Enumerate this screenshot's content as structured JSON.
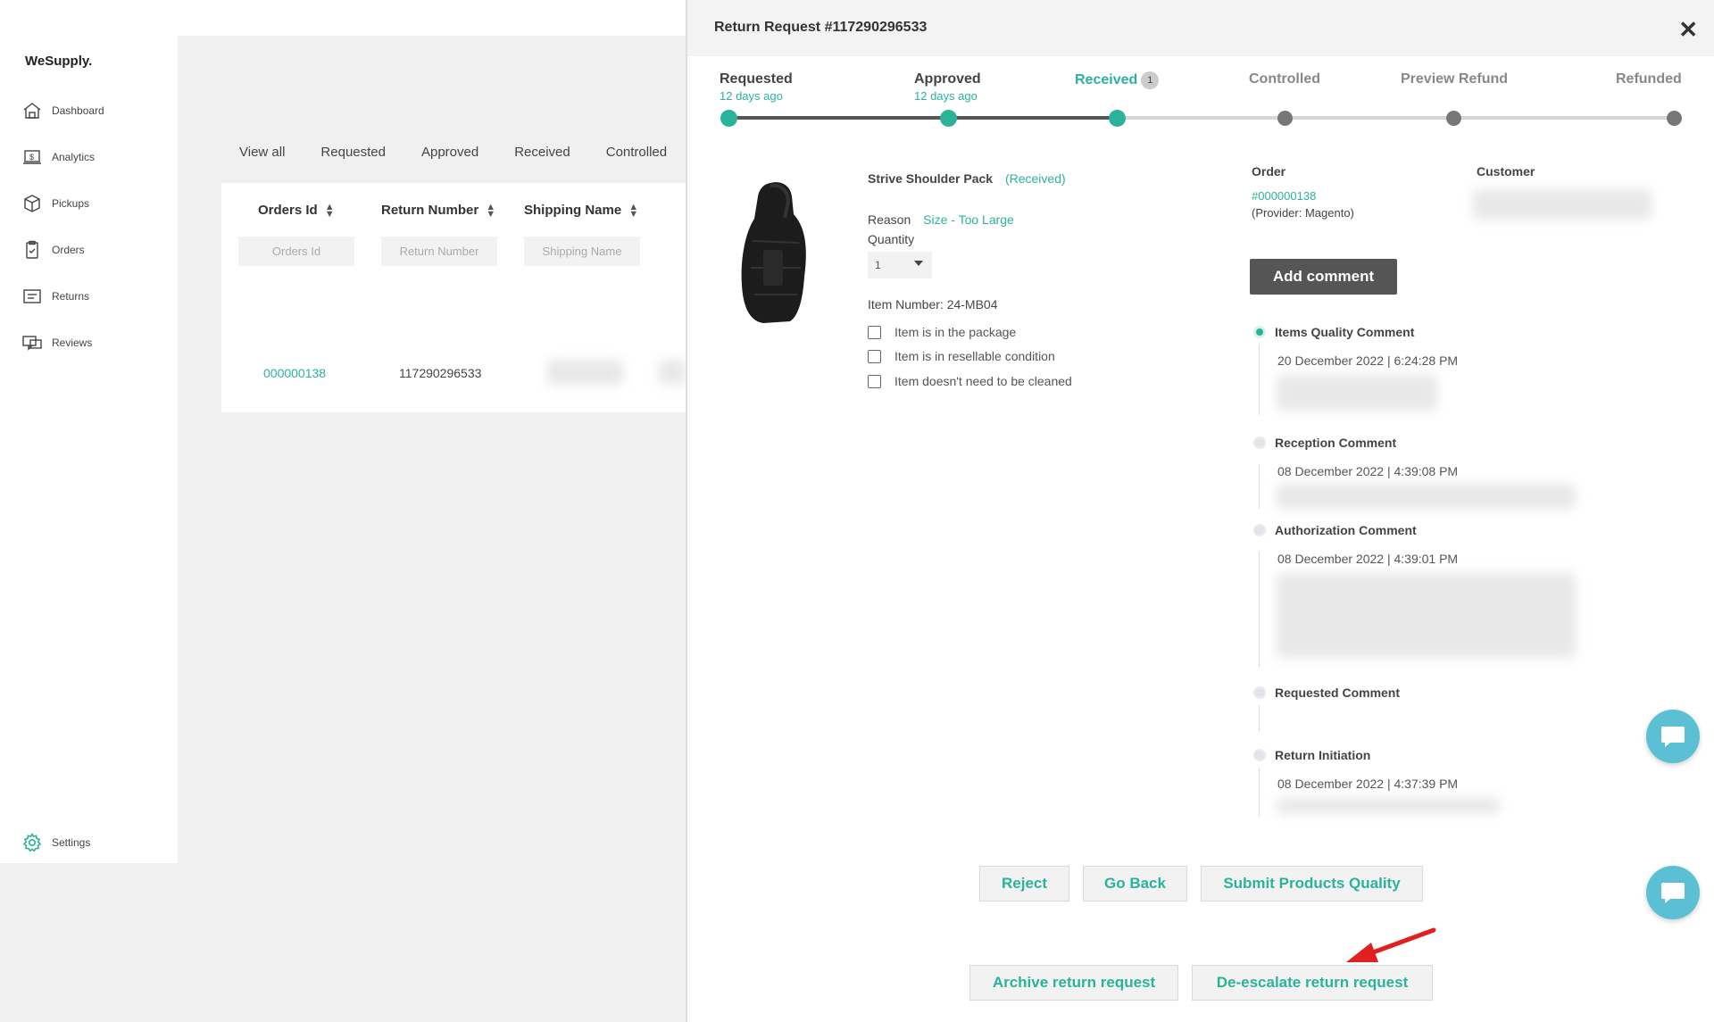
{
  "sidebar": {
    "brand": "WeSupply.",
    "items": [
      {
        "label": "Dashboard",
        "icon": "dashboard-icon"
      },
      {
        "label": "Analytics",
        "icon": "analytics-icon"
      },
      {
        "label": "Pickups",
        "icon": "pickups-icon"
      },
      {
        "label": "Orders",
        "icon": "orders-icon"
      },
      {
        "label": "Returns",
        "icon": "returns-icon"
      },
      {
        "label": "Reviews",
        "icon": "reviews-icon"
      }
    ],
    "settings": {
      "label": "Settings",
      "icon": "gear-icon"
    }
  },
  "list": {
    "tabs": [
      "View all",
      "Requested",
      "Approved",
      "Received",
      "Controlled"
    ],
    "columns": [
      {
        "label": "Orders Id",
        "placeholder": "Orders Id"
      },
      {
        "label": "Return Number",
        "placeholder": "Return Number"
      },
      {
        "label": "Shipping Name",
        "placeholder": "Shipping Name"
      }
    ],
    "row": {
      "order_id": "000000138",
      "return_number": "117290296533"
    }
  },
  "panel": {
    "title": "Return Request #117290296533",
    "steps": [
      {
        "label": "Requested",
        "sub": "12 days ago",
        "state": "done"
      },
      {
        "label": "Approved",
        "sub": "12 days ago",
        "state": "done"
      },
      {
        "label": "Received",
        "sub": "",
        "state": "current",
        "badge": "1"
      },
      {
        "label": "Controlled",
        "sub": "",
        "state": "pending"
      },
      {
        "label": "Preview Refund",
        "sub": "",
        "state": "pending"
      },
      {
        "label": "Refunded",
        "sub": "",
        "state": "pending"
      }
    ],
    "product": {
      "name": "Strive Shoulder Pack",
      "status": "(Received)",
      "reason_label": "Reason",
      "reason_value": "Size - Too Large",
      "quantity_label": "Quantity",
      "quantity_value": "1",
      "item_number": "Item Number: 24-MB04",
      "checks": [
        "Item is in the package",
        "Item is in resellable condition",
        "Item doesn't need to be cleaned"
      ]
    },
    "order": {
      "label": "Order",
      "number": "#000000138",
      "provider": "(Provider: Magento)",
      "customer_label": "Customer"
    },
    "add_comment": "Add comment",
    "timeline": [
      {
        "title": "Items Quality Comment",
        "date": "20 December 2022 | 6:24:28 PM",
        "active": true
      },
      {
        "title": "Reception Comment",
        "date": "08 December 2022 | 4:39:08 PM",
        "active": false
      },
      {
        "title": "Authorization Comment",
        "date": "08 December 2022 | 4:39:01 PM",
        "active": false
      },
      {
        "title": "Requested Comment",
        "date": "",
        "active": false
      },
      {
        "title": "Return Initiation",
        "date": "08 December 2022 | 4:37:39 PM",
        "active": false
      }
    ],
    "buttons": {
      "reject": "Reject",
      "go_back": "Go Back",
      "submit": "Submit Products Quality",
      "archive": "Archive return request",
      "deescalate": "De-escalate return request"
    }
  },
  "colors": {
    "accent": "#2bb39a",
    "dark_button": "#555555",
    "arrow": "#e02020",
    "chat": "#5cc0d4"
  }
}
